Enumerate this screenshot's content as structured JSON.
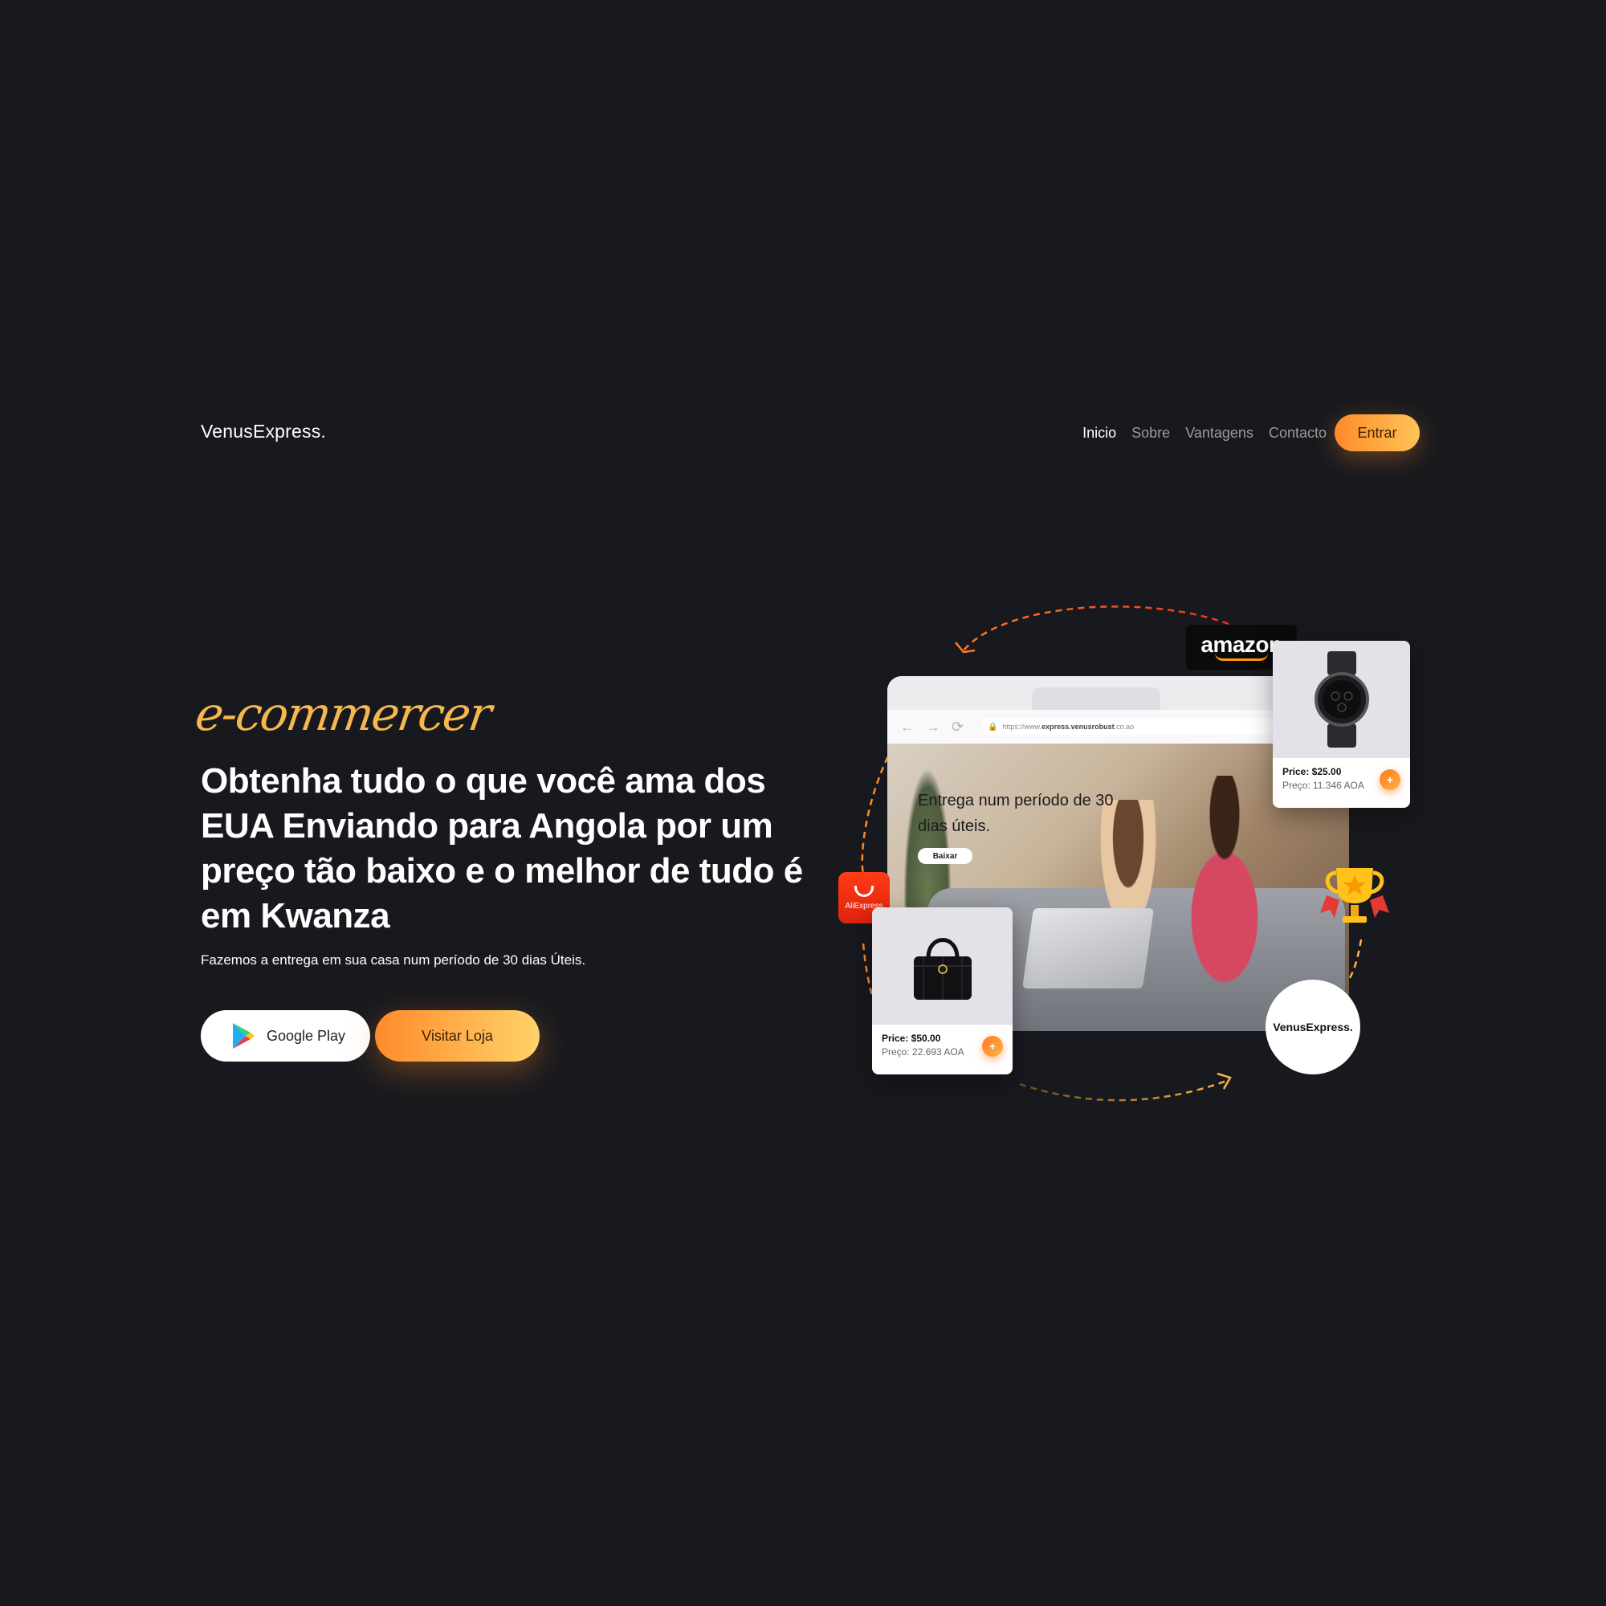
{
  "brand": {
    "logo": "VenusExpress."
  },
  "nav": {
    "items": [
      {
        "label": "Inicio",
        "active": true
      },
      {
        "label": "Sobre",
        "active": false
      },
      {
        "label": "Vantagens",
        "active": false
      },
      {
        "label": "Contacto",
        "active": false
      }
    ],
    "cta_label": "Entrar"
  },
  "hero": {
    "script_label": "e-commercer",
    "headline": "Obtenha tudo o que você ama dos EUA Enviando para Angola por um preço tão baixo e o melhor de tudo é em Kwanza",
    "subtitle": "Fazemos a entrega em sua casa num período de 30 dias Úteis.",
    "google_play_label": "Google Play",
    "store_button_label": "Visitar Loja"
  },
  "illustration": {
    "browser": {
      "url_prefix": "https://www.",
      "url_domain": "express.venusrobust",
      "url_suffix": ".co.ao",
      "promo_text": "Entrega num período de 30 dias úteis.",
      "promo_button": "Baixar"
    },
    "watch_card": {
      "price": "Price: $25.00",
      "preco": "Preço: 11.346 AOA",
      "add_label": "+"
    },
    "bag_card": {
      "price": "Price: $50.00",
      "preco": "Preço: 22.693 AOA",
      "add_label": "+"
    },
    "amazon_label": "amazon",
    "aliexpress_label": "AliExpress",
    "venus_badge": "VenusExpress."
  },
  "colors": {
    "background": "#18191e",
    "accent_start": "#ff8a2a",
    "accent_end": "#ffc456",
    "script": "#f6b84d"
  },
  "icons": [
    "google-play-icon",
    "lock-icon",
    "back-arrow-icon",
    "forward-arrow-icon",
    "reload-icon",
    "plus-icon",
    "trophy-icon",
    "watch-image",
    "handbag-image"
  ]
}
